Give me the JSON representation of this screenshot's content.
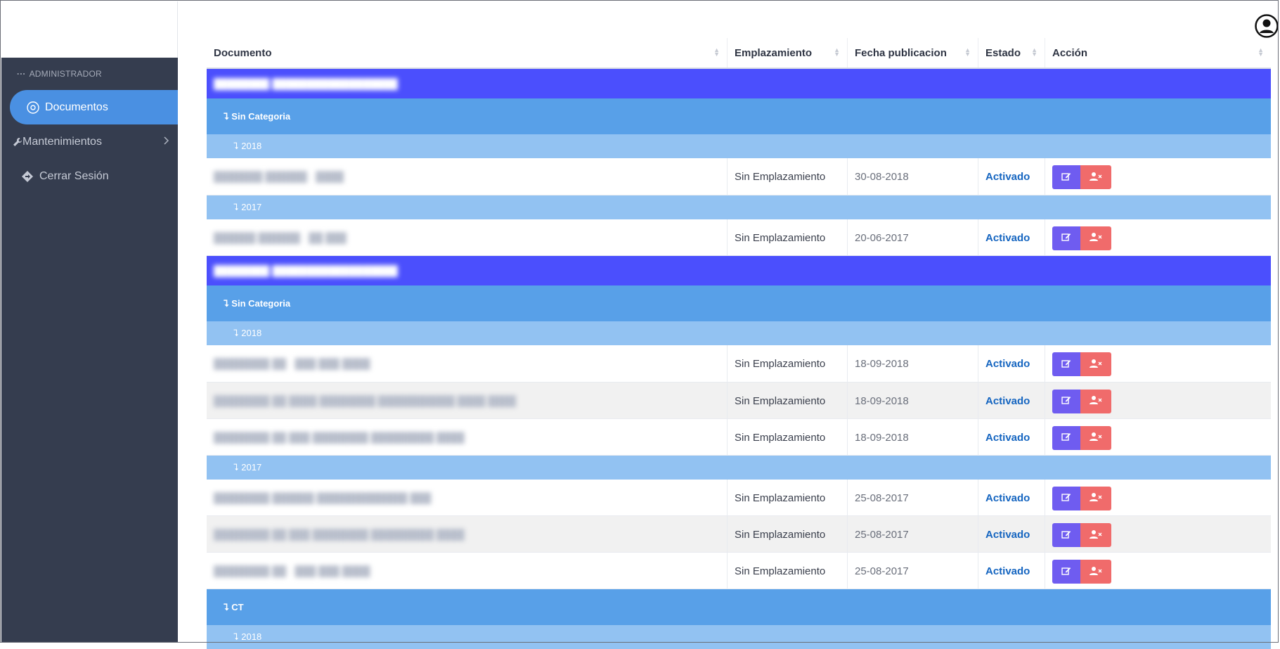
{
  "sidebar": {
    "section_label": "ADMINISTRADOR",
    "items": [
      {
        "label": "Documentos",
        "icon": "target-circle-icon",
        "active": true
      },
      {
        "label": "Mantenimientos",
        "icon": "wrench-icon",
        "active": false
      },
      {
        "label": "Cerrar Sesión",
        "icon": "signpost-diamond-icon",
        "active": false
      }
    ]
  },
  "table": {
    "headers": [
      "Documento",
      "Emplazamiento",
      "Fecha publicacion",
      "Estado",
      "Acción"
    ],
    "groups": [
      {
        "user": "████████ ██████████████████",
        "category": "Sin Categoria",
        "years": [
          {
            "year": "2018",
            "rows": [
              {
                "doc": "███████ ██████ · ████",
                "location": "Sin Emplazamiento",
                "date": "30-08-2018",
                "status": "Activado"
              }
            ]
          },
          {
            "year": "2017",
            "rows": [
              {
                "doc": "██████ ██████ · ██ ███",
                "location": "Sin Emplazamiento",
                "date": "20-06-2017",
                "status": "Activado"
              }
            ]
          }
        ]
      },
      {
        "user": "████████ ██████████████████",
        "category": "Sin Categoria",
        "years": [
          {
            "year": "2018",
            "rows": [
              {
                "doc": "████████ ██ · ███ ███ ████",
                "location": "Sin Emplazamiento",
                "date": "18-09-2018",
                "status": "Activado"
              },
              {
                "doc": "████████ ██ ████ ████████ ███████████ ████ ████",
                "location": "Sin Emplazamiento",
                "date": "18-09-2018",
                "status": "Activado"
              },
              {
                "doc": "████████ ██ ███ ████████ █████████ ████",
                "location": "Sin Emplazamiento",
                "date": "18-09-2018",
                "status": "Activado"
              }
            ]
          },
          {
            "year": "2017",
            "rows": [
              {
                "doc": "████████ ██████ █████████████ ███",
                "location": "Sin Emplazamiento",
                "date": "25-08-2017",
                "status": "Activado"
              },
              {
                "doc": "████████ ██ ███ ████████ █████████ ████",
                "location": "Sin Emplazamiento",
                "date": "25-08-2017",
                "status": "Activado"
              },
              {
                "doc": "████████ ██ · ███ ███ ████",
                "location": "Sin Emplazamiento",
                "date": "25-08-2017",
                "status": "Activado"
              }
            ]
          }
        ]
      },
      {
        "user": null,
        "category": "CT",
        "years": [
          {
            "year": "2018",
            "rows": []
          }
        ]
      }
    ]
  },
  "colors": {
    "sidebar_bg": "#353d4f",
    "active_nav": "#4a90e2",
    "user_row": "#4b4ffd",
    "category_row": "#58a0e8",
    "year_row": "#92c2f2",
    "edit_button": "#6f5cf0",
    "delete_button": "#f06b6b",
    "status_text": "#1565c0"
  }
}
